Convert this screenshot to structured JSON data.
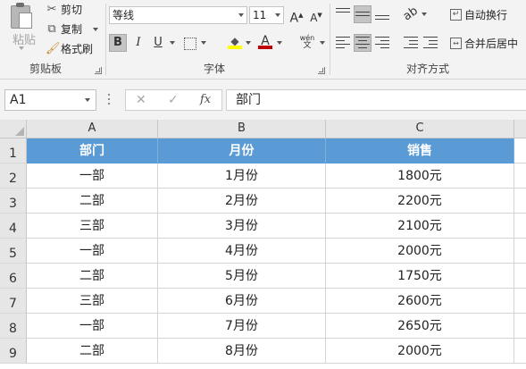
{
  "ribbon": {
    "clipboard": {
      "paste_label": "粘贴",
      "cut_label": "剪切",
      "copy_label": "复制",
      "format_painter_label": "格式刷",
      "group_label": "剪贴板"
    },
    "font": {
      "font_name": "等线",
      "font_size": "11",
      "grow_label": "A",
      "shrink_label": "A",
      "bold_label": "B",
      "italic_label": "I",
      "underline_label": "U",
      "phonetic_top": "wén",
      "phonetic_bottom": "文",
      "font_color_label": "A",
      "group_label": "字体",
      "highlight_color": "#ffff00",
      "font_color": "#c00000"
    },
    "alignment": {
      "wrap_text_label": "自动换行",
      "merge_center_label": "合并后居中",
      "group_label": "对齐方式"
    }
  },
  "formula_bar": {
    "name_box": "A1",
    "cancel_icon": "✕",
    "enter_icon": "✓",
    "fx_label": "fx",
    "formula": "部门"
  },
  "sheet": {
    "columns": [
      "A",
      "B",
      "C"
    ],
    "row_numbers": [
      "1",
      "2",
      "3",
      "4",
      "5",
      "6",
      "7",
      "8",
      "9"
    ],
    "header_fill": "#5b9bd5",
    "rows": [
      [
        "部门",
        "月份",
        "销售"
      ],
      [
        "一部",
        "1月份",
        "1800元"
      ],
      [
        "二部",
        "2月份",
        "2200元"
      ],
      [
        "三部",
        "3月份",
        "2100元"
      ],
      [
        "一部",
        "4月份",
        "2000元"
      ],
      [
        "二部",
        "5月份",
        "1750元"
      ],
      [
        "三部",
        "6月份",
        "2600元"
      ],
      [
        "一部",
        "7月份",
        "2650元"
      ],
      [
        "二部",
        "8月份",
        "2000元"
      ]
    ]
  }
}
